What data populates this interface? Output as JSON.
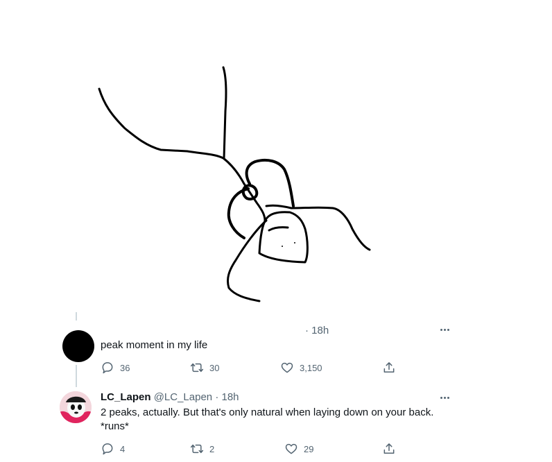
{
  "tweet1": {
    "time": "· 18h",
    "text": "peak moment in my life",
    "reply_count": "36",
    "retweet_count": "30",
    "like_count": "3,150",
    "icons": [
      "reply-icon",
      "retweet-icon",
      "like-icon",
      "share-icon",
      "more-icon"
    ]
  },
  "tweet2": {
    "name": "LC_Lapen",
    "handle": "@LC_Lapen",
    "time": "· 18h",
    "text_line1": "2 peaks, actually. But that's only natural when laying down on your back.",
    "text_line2": "*runs*",
    "reply_count": "4",
    "retweet_count": "2",
    "like_count": "29",
    "icons": [
      "reply-icon",
      "retweet-icon",
      "like-icon",
      "share-icon",
      "more-icon"
    ]
  },
  "colors": {
    "text": "#0f1419",
    "secondary": "#536471",
    "thread_line": "#cfd9de",
    "avatar_bg": "#000000",
    "avatar_accent": "#e0245e"
  }
}
